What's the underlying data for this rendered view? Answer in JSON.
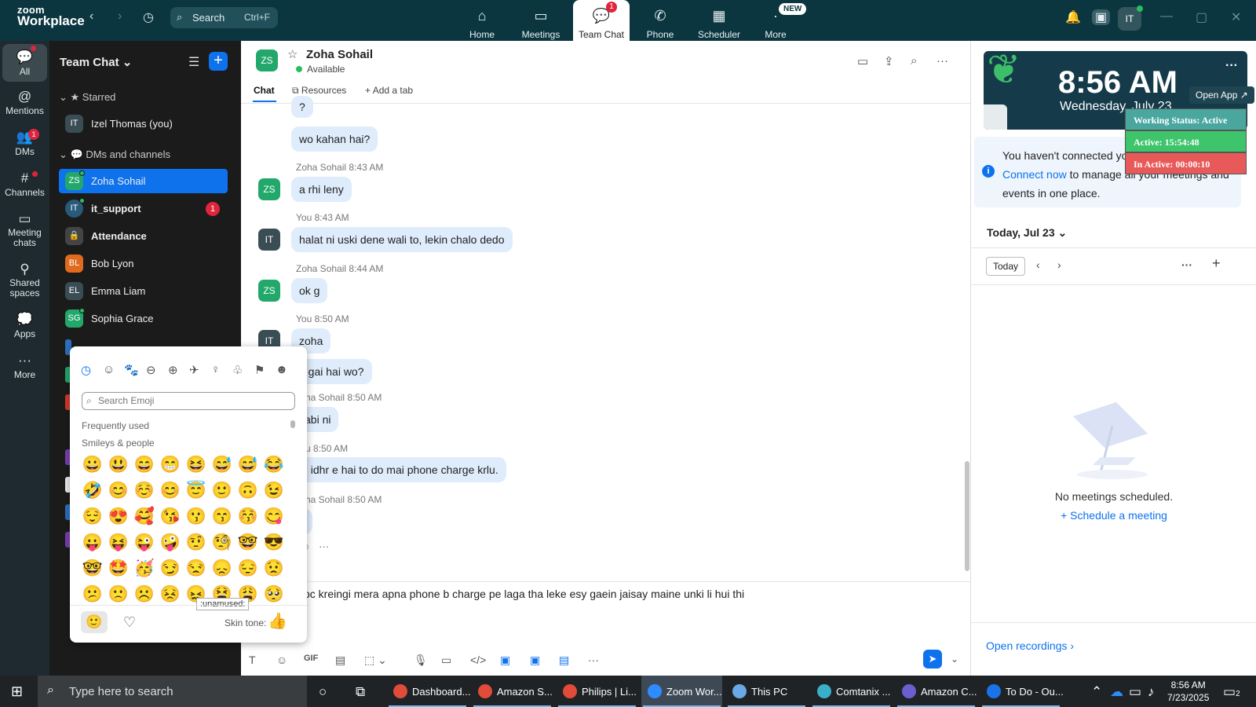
{
  "app": {
    "logo_line1": "zoom",
    "logo_line2": "Workplace",
    "search_label": "Search",
    "search_shortcut": "Ctrl+F"
  },
  "nav": [
    {
      "label": "Home",
      "icon": "home-icon"
    },
    {
      "label": "Meetings",
      "icon": "video-icon"
    },
    {
      "label": "Team Chat",
      "icon": "chat-icon",
      "badge": "1",
      "active": true
    },
    {
      "label": "Phone",
      "icon": "phone-icon"
    },
    {
      "label": "Scheduler",
      "icon": "calendar-icon"
    },
    {
      "label": "More",
      "icon": "more-icon",
      "new_badge": "NEW"
    }
  ],
  "topbar_avatar": "IT",
  "rail": [
    {
      "label": "All",
      "icon": "chat-bubble-icon",
      "active": true
    },
    {
      "label": "Mentions",
      "icon": "at-icon"
    },
    {
      "label": "DMs",
      "icon": "people-icon",
      "badge": "1"
    },
    {
      "label": "Channels",
      "icon": "hash-icon"
    },
    {
      "label": "Meeting chats",
      "icon": "meeting-chat-icon"
    },
    {
      "label": "Shared spaces",
      "icon": "shared-spaces-icon"
    },
    {
      "label": "Apps",
      "icon": "apps-icon"
    },
    {
      "label": "More",
      "icon": "ellipsis-icon"
    }
  ],
  "sidebar": {
    "title": "Team Chat",
    "sections": {
      "starred": "Starred",
      "dms": "DMs and channels"
    },
    "starred_items": [
      {
        "initials": "IT",
        "name": "Izel Thomas (you)",
        "color": "#3a4d55"
      }
    ],
    "items": [
      {
        "initials": "ZS",
        "name": "Zoha Sohail",
        "color": "#23a86c",
        "selected": true
      },
      {
        "initials": "IT",
        "name": "it_support",
        "color": "#2a5a7a",
        "bold": true,
        "badge": "1"
      },
      {
        "initials": "",
        "name": "Attendance",
        "color": "#555555",
        "bold": true
      },
      {
        "initials": "BL",
        "name": "Bob Lyon",
        "color": "#e06b1f"
      },
      {
        "initials": "EL",
        "name": "Emma Liam",
        "color": "#3a4d55"
      },
      {
        "initials": "SG",
        "name": "Sophia Grace",
        "color": "#23a86c"
      }
    ]
  },
  "chat": {
    "contact_initials": "ZS",
    "contact_name": "Zoha Sohail",
    "status": "Available",
    "tabs": {
      "chat": "Chat",
      "resources": "Resources",
      "add": "Add a tab"
    },
    "messages": [
      {
        "text": "?"
      },
      {
        "text": "wo kahan hai?"
      },
      {
        "sender": "Zoha Sohail",
        "time": "8:43 AM",
        "avatar": "ZS",
        "text": "a rhi leny"
      },
      {
        "sender": "You",
        "time": "8:43 AM",
        "avatar": "IT",
        "text": "halat ni uski dene wali to, lekin chalo dedo"
      },
      {
        "sender": "Zoha Sohail",
        "time": "8:44 AM",
        "avatar": "ZS",
        "text": "ok g"
      },
      {
        "sender": "You",
        "time": "8:50 AM",
        "avatar": "IT",
        "text": "zoha"
      },
      {
        "text": "e gai hai wo?"
      },
      {
        "sender": "ha Sohail",
        "time": "8:50 AM",
        "text": "i abi ni"
      },
      {
        "sender": "u",
        "time": "8:50 AM",
        "text": "bi idhr e hai to do mai phone charge krlu."
      },
      {
        "sender": "ha Sohail",
        "time": "8:50 AM",
        "text": "k"
      }
    ],
    "composer_text": "oc kreingi mera apna phone b charge pe laga tha leke esy gaein jaisay maine unki li hui thi"
  },
  "emoji_picker": {
    "search_placeholder": "Search Emoji",
    "frequently_used": "Frequently used",
    "section": "Smileys & people",
    "tooltip": ":unamused:",
    "skin_tone_label": "Skin tone:",
    "skin_tone": "👍",
    "emojis": [
      "😀",
      "😃",
      "😄",
      "😁",
      "😆",
      "😅",
      "😅",
      "😂",
      "🤣",
      "😊",
      "☺️",
      "😊",
      "😇",
      "🙂",
      "🙃",
      "😉",
      "😌",
      "😍",
      "🥰",
      "😘",
      "😗",
      "😙",
      "😚",
      "😋",
      "😛",
      "😝",
      "😜",
      "🤪",
      "🤨",
      "🧐",
      "🤓",
      "😎",
      "🤓",
      "🤩",
      "🥳",
      "😏",
      "😒",
      "😞",
      "😔",
      "😟",
      "😕",
      "🙁",
      "☹️",
      "😣",
      "😖",
      "😫",
      "😩",
      "🥺"
    ]
  },
  "calendar": {
    "clock": "8:56 AM",
    "date": "Wednesday, July 23",
    "open_app": "Open App ↗",
    "notice_pre": "You haven't connected your calendar yet.",
    "notice_link": "Connect now",
    "notice_post": "to manage all your meetings and events in one place.",
    "today_heading": "Today, Jul 23",
    "today_button": "Today",
    "empty": "No meetings scheduled.",
    "schedule": "Schedule a meeting",
    "recordings": "Open recordings"
  },
  "work_status": {
    "status": "Working Status: Active",
    "active": "Active: 15:54:48",
    "inactive": "In Active: 00:00:10"
  },
  "taskbar": {
    "search_placeholder": "Type here to search",
    "apps": [
      {
        "label": "Dashboard...",
        "color": "#e04b3a"
      },
      {
        "label": "Amazon S...",
        "color": "#e04b3a"
      },
      {
        "label": "Philips | Li...",
        "color": "#e04b3a"
      },
      {
        "label": "Zoom Wor...",
        "color": "#2d8cff",
        "active": true
      },
      {
        "label": "This PC",
        "color": "#6aa9e8"
      },
      {
        "label": "Comtanix ...",
        "color": "#3ab0c8"
      },
      {
        "label": "Amazon C...",
        "color": "#6b5fd0"
      },
      {
        "label": "To Do - Ou...",
        "color": "#1a73e8"
      }
    ],
    "time": "8:56 AM",
    "date": "7/23/2025",
    "notif_count": "2"
  }
}
